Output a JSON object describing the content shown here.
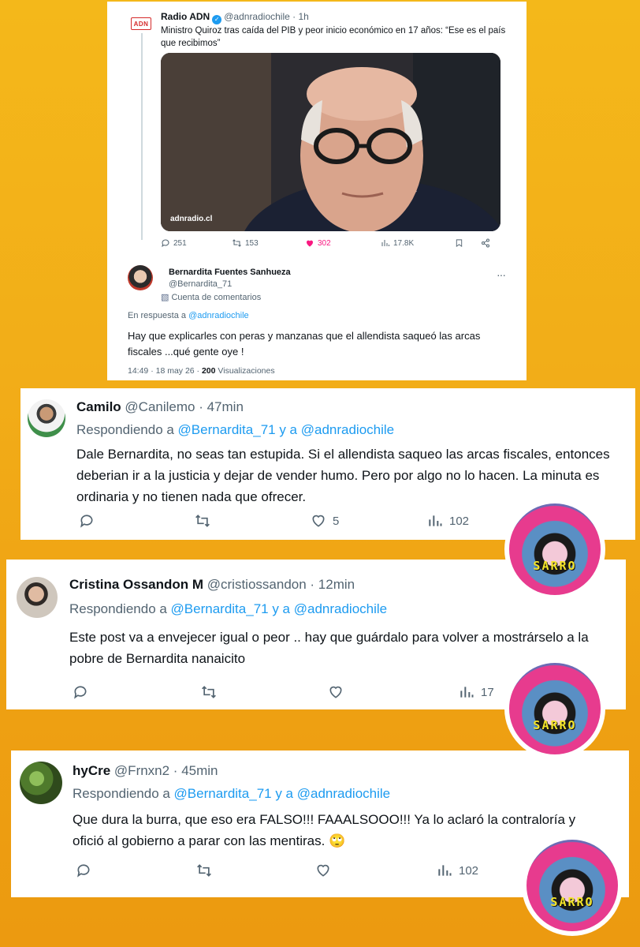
{
  "main_tweet": {
    "logo_text": "ADN",
    "author": "Radio ADN",
    "meta": "@adnradiochile · 1h",
    "title": "Ministro Quiroz tras caída del PIB y peor inicio económico en 17 años: “Ese es el país que recibimos”",
    "photo_caption": "adnradio.cl",
    "replies": "251",
    "reposts": "153",
    "likes": "302",
    "views": "17.8K"
  },
  "reply_tweet": {
    "author": "Bernardita Fuentes Sanhueza",
    "handle": "@Bernardita_71",
    "account_tag": "Cuenta de comentarios",
    "in_reply_prefix": "En respuesta a ",
    "in_reply_handle": "@adnradiochile",
    "text": "Hay que explicarles con peras y manzanas que el allendista saqueó las arcas fiscales ...qué gente oye !",
    "time": "14:49 · 18 may 26 · ",
    "views_count": "200",
    "views_label": " Visualizaciones"
  },
  "comments": [
    {
      "name": "Camilo",
      "meta": "@Canilemo · 47min",
      "replying_prefix": "Respondiendo a ",
      "replying_handles": "@Bernardita_71 y a @adnradiochile",
      "text": "Dale Bernardita, no seas tan estupida. Si el allendista saqueo las arcas fiscales, entonces deberian ir a la justicia y dejar de vender humo. Pero por algo no lo hacen. La minuta es ordinaria y no tienen nada que ofrecer.",
      "likes": "5",
      "views": "102"
    },
    {
      "name": "Cristina Ossandon M",
      "meta": "@cristiossandon · 12min",
      "replying_prefix": "Respondiendo a ",
      "replying_handles": "@Bernardita_71 y a @adnradiochile",
      "text": "Este post va a envejecer igual o peor .. hay que guárdalo para volver a mostrárselo a la pobre de Bernardita nanaicito",
      "likes": "",
      "views": "17"
    },
    {
      "name": "hyCre",
      "meta": "@Frnxn2 · 45min",
      "replying_prefix": "Respondiendo a ",
      "replying_handles": "@Bernardita_71 y a @adnradiochile",
      "text": "Que dura la burra, que eso era FALSO!!! FAAALSOOO!!! Ya lo aclaró la contraloría y ofició al gobierno a parar con las mentiras. 🙄",
      "likes": "",
      "views": "102"
    }
  ],
  "badge_text": "SARRO",
  "colors": {
    "background": "#f2ad18",
    "link": "#1d9bf0",
    "like": "#f91880",
    "muted": "#536471"
  }
}
